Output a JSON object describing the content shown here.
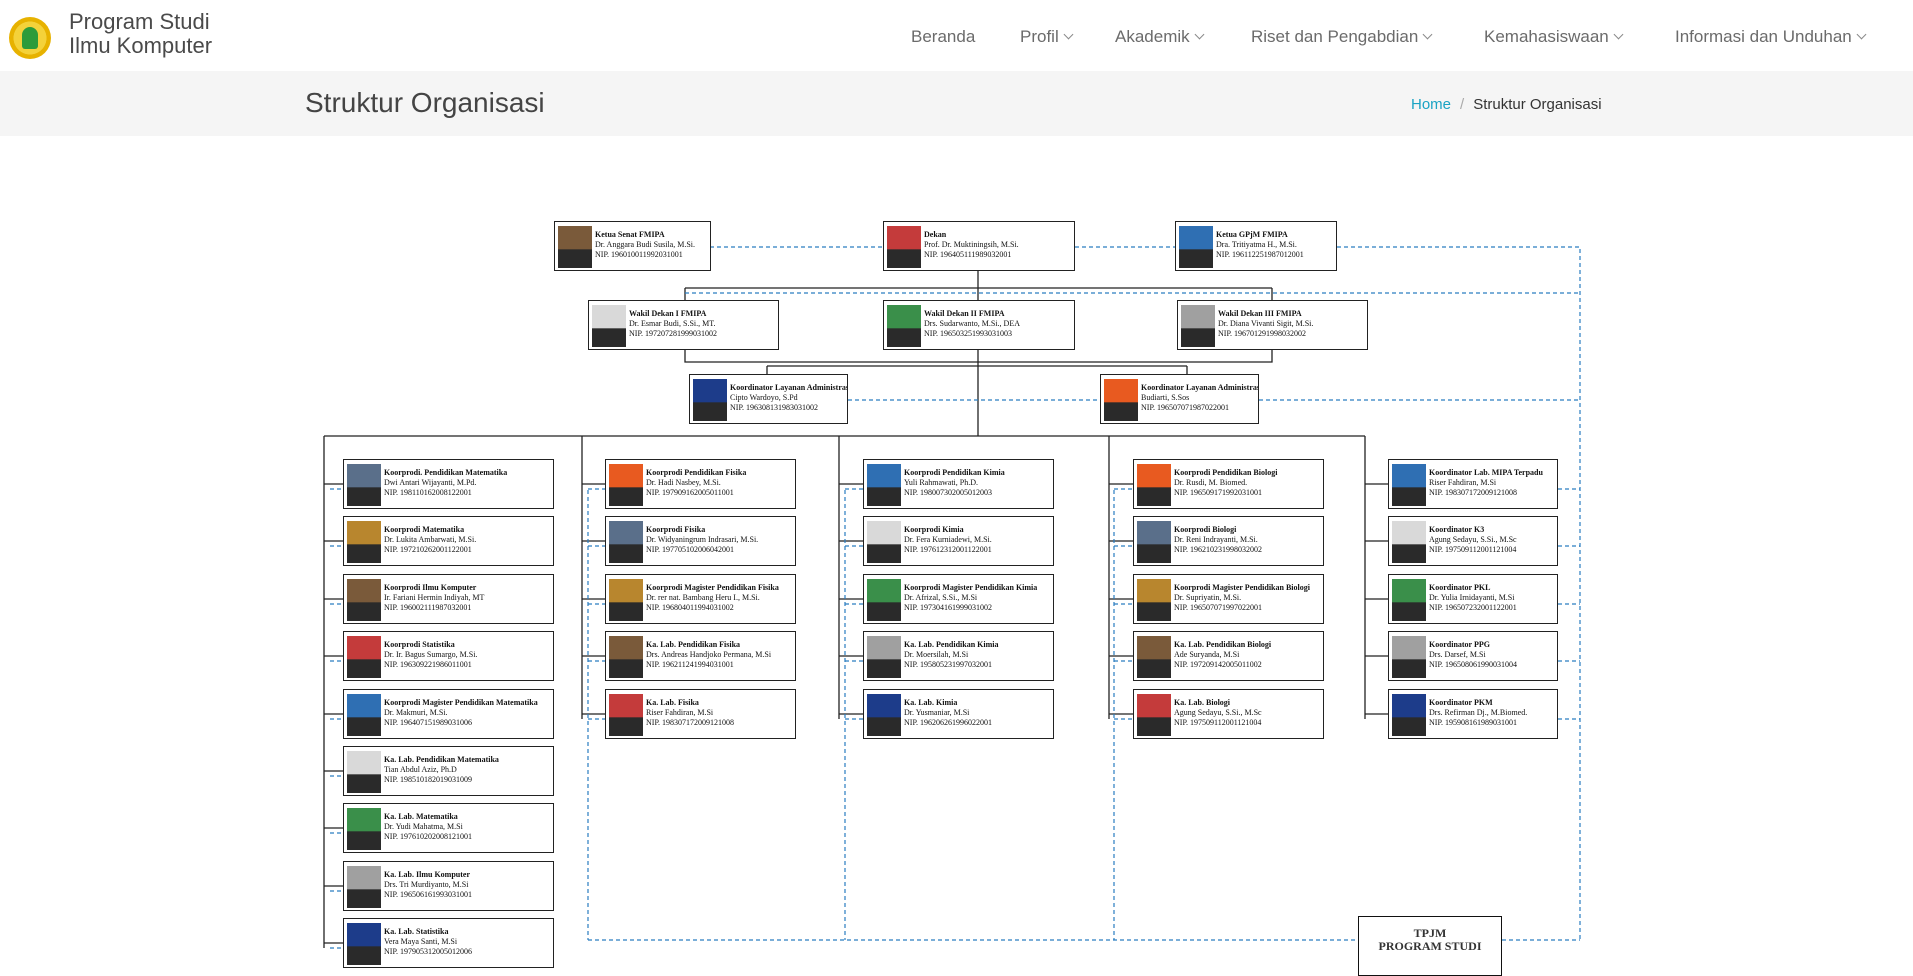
{
  "brand": {
    "line1": "Program Studi",
    "line2": "Ilmu Komputer"
  },
  "nav": [
    {
      "label": "Beranda",
      "dropdown": false
    },
    {
      "label": "Profil",
      "dropdown": true
    },
    {
      "label": "Akademik",
      "dropdown": true
    },
    {
      "label": "Riset dan Pengabdian",
      "dropdown": true
    },
    {
      "label": "Kemahasiswaan",
      "dropdown": true
    },
    {
      "label": "Informasi dan Unduhan",
      "dropdown": true
    }
  ],
  "page_title": "Struktur Organisasi",
  "breadcrumb": {
    "home": "Home",
    "current": "Struktur Organisasi"
  },
  "org_chart": {
    "leadership": [
      {
        "role": "Ketua Senat FMIPA",
        "name": "Dr. Anggara Budi Susila, M.Si.",
        "nip": "NIP. 196010011992031001"
      },
      {
        "role": "Dekan",
        "name": "Prof. Dr. Muktiningsih, M.Si.",
        "nip": "NIP. 196405111989032001"
      },
      {
        "role": "Ketua GPjM FMIPA",
        "name": "Dra. Tritiyatma H., M.Si.",
        "nip": "NIP. 196112251987012001"
      },
      {
        "role": "Wakil Dekan I FMIPA",
        "name": "Dr. Esmar Budi, S.Si., MT.",
        "nip": "NIP. 197207281999031002"
      },
      {
        "role": "Wakil Dekan II FMIPA",
        "name": "Drs. Sudarwanto, M.Si., DEA",
        "nip": "NIP. 196503251993031003"
      },
      {
        "role": "Wakil Dekan III FMIPA",
        "name": "Dr.  Diana Vivanti Sigit, M.Si.",
        "nip": "NIP. 196701291998032002"
      },
      {
        "role": "Koordinator Layanan Administrasi Akademik",
        "name": "Cipto Wardoyo, S.Pd",
        "nip": "NIP. 196308131983031002"
      },
      {
        "role": "Koordinator Layanan Administrasi Umum",
        "name": "Budiarti, S.Sos",
        "nip": "NIP. 196507071987022001"
      }
    ],
    "columns": [
      [
        {
          "role": "Koorprodi. Pendidikan Matematika",
          "name": "Dwi Antari Wijayanti, M.Pd.",
          "nip": "NIP. 198110162008122001"
        },
        {
          "role": "Koorprodi Matematika",
          "name": "Dr. Lukita Ambarwati, M.Si.",
          "nip": "NIP. 197210262001122001"
        },
        {
          "role": "Koorprodi Ilmu Komputer",
          "name": "Ir. Fariani Hermin Indiyah, MT",
          "nip": "NIP. 196002111987032001"
        },
        {
          "role": "Koorprodi Statistika",
          "name": "Dr. Ir. Bagus Sumargo, M.Si.",
          "nip": "NIP. 196309221986011001"
        },
        {
          "role": "Koorprodi Magister Pendidikan Matematika",
          "name": "Dr. Makmuri, M.Si.",
          "nip": "NIP. 196407151989031006"
        },
        {
          "role": "Ka. Lab. Pendidikan Matematika",
          "name": "Tian Abdul Aziz, Ph.D",
          "nip": "NIP. 198510182019031009"
        },
        {
          "role": "Ka. Lab. Matematika",
          "name": "Dr. Yudi Mahatma, M.Si",
          "nip": "NIP. 197610202008121001"
        },
        {
          "role": "Ka. Lab. Ilmu Komputer",
          "name": "Drs. Tri Murdiyanto, M.Si",
          "nip": "NIP. 196506161993031001"
        },
        {
          "role": "Ka. Lab. Statistika",
          "name": "Vera Maya Santi, M.Si",
          "nip": "NIP. 197905312005012006"
        }
      ],
      [
        {
          "role": "Koorprodi Pendidikan Fisika",
          "name": "Dr. Hadi Nasbey, M.Si.",
          "nip": "NIP. 197909162005011001"
        },
        {
          "role": "Koorprodi Fisika",
          "name": "Dr. Widyaningrum Indrasari, M.Si.",
          "nip": "NIP. 197705102006042001"
        },
        {
          "role": "Koorprodi Magister Pendidikan Fisika",
          "name": "Dr. rer nat. Bambang Heru I., M.Si.",
          "nip": "NIP. 196804011994031002"
        },
        {
          "role": "Ka. Lab. Pendidikan Fisika",
          "name": "Drs. Andreas Handjoko Permana, M.Si",
          "nip": "NIP. 196211241994031001"
        },
        {
          "role": "Ka. Lab. Fisika",
          "name": "Riser Fahdiran, M.Si",
          "nip": "NIP. 198307172009121008"
        }
      ],
      [
        {
          "role": "Koorprodi Pendidikan Kimia",
          "name": "Yuli Rahmawati, Ph.D.",
          "nip": "NIP. 198007302005012003"
        },
        {
          "role": "Koorprodi Kimia",
          "name": "Dr. Fera Kurniadewi, M.Si.",
          "nip": "NIP. 197612312001122001"
        },
        {
          "role": "Koorprodi Magister Pendidikan Kimia",
          "name": "Dr. Afrizal, S.Si., M.Si",
          "nip": "NIP. 197304161999031002"
        },
        {
          "role": "Ka. Lab. Pendidikan Kimia",
          "name": "Dr. Moersilah, M.Si",
          "nip": "NIP. 195805231997032001"
        },
        {
          "role": "Ka. Lab. Kimia",
          "name": "Dr. Yusmaniar, M.Si",
          "nip": "NIP. 196206261996022001"
        }
      ],
      [
        {
          "role": "Koorprodi Pendidikan Biologi",
          "name": "Dr. Rusdi, M. Biomed.",
          "nip": "NIP. 196509171992031001"
        },
        {
          "role": "Koorprodi Biologi",
          "name": "Dr. Reni Indrayanti, M.Si.",
          "nip": "NIP. 196210231998032002"
        },
        {
          "role": "Koorprodi Magister Pendidikan Biologi",
          "name": "Dr. Supriyatin, M.Si.",
          "nip": "NIP. 196507071997022001"
        },
        {
          "role": "Ka. Lab. Pendidikan Biologi",
          "name": "Ade Suryanda, M.Si",
          "nip": "NIP. 197209142005011002"
        },
        {
          "role": "Ka. Lab. Biologi",
          "name": "Agung Sedayu, S.Si., M.Sc",
          "nip": "NIP. 197509112001121004"
        }
      ],
      [
        {
          "role": "Koordinator Lab. MIPA Terpadu",
          "name": "Riser Fahdiran, M.Si",
          "nip": "NIP. 198307172009121008"
        },
        {
          "role": "Koordinator K3",
          "name": "Agung Sedayu, S.Si., M.Sc",
          "nip": "NIP. 197509112001121004"
        },
        {
          "role": "Koordinator PKL",
          "name": "Dr. Yulia Irnidayanti, M.Si",
          "nip": "NIP. 196507232001122001"
        },
        {
          "role": "Koordinator PPG",
          "name": "Drs. Darsef, M.Si",
          "nip": "NIP. 196508061990031004"
        },
        {
          "role": "Koordinator PKM",
          "name": "Drs. Refirman Dj., M.Biomed.",
          "nip": "NIP. 195908161989031001"
        }
      ]
    ],
    "tpjm": {
      "line1": "TPJM",
      "line2": "PROGRAM STUDI"
    }
  }
}
